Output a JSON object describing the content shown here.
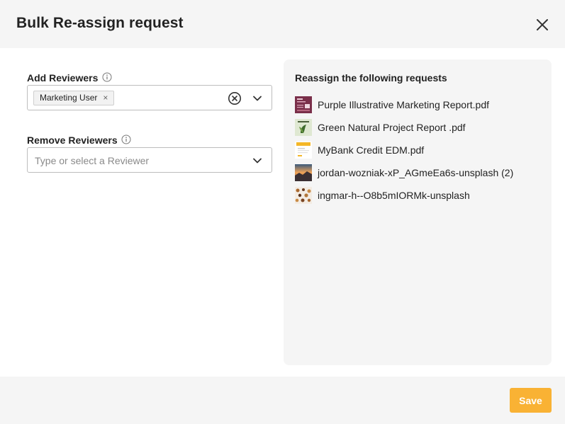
{
  "dialog": {
    "title": "Bulk Re-assign request"
  },
  "add_reviewers": {
    "label": "Add Reviewers",
    "selected": [
      "Marketing User"
    ]
  },
  "remove_reviewers": {
    "label": "Remove Reviewers",
    "placeholder": "Type or select a Reviewer"
  },
  "requests_panel": {
    "title": "Reassign the following requests",
    "files": [
      {
        "name": "Purple Illustrative Marketing Report.pdf",
        "thumb": "purple-report-thumbnail"
      },
      {
        "name": "Green Natural Project Report .pdf",
        "thumb": "green-report-thumbnail"
      },
      {
        "name": "MyBank Credit EDM.pdf",
        "thumb": "mybank-edm-thumbnail"
      },
      {
        "name": "jordan-wozniak-xP_AGmeEa6s-unsplash (2)",
        "thumb": "sunset-photo-thumbnail"
      },
      {
        "name": "ingmar-h--O8b5mIORMk-unsplash",
        "thumb": "pattern-photo-thumbnail"
      }
    ]
  },
  "footer": {
    "save_label": "Save"
  },
  "colors": {
    "accent": "#f9b234",
    "panel_bg": "#f5f5f5"
  }
}
